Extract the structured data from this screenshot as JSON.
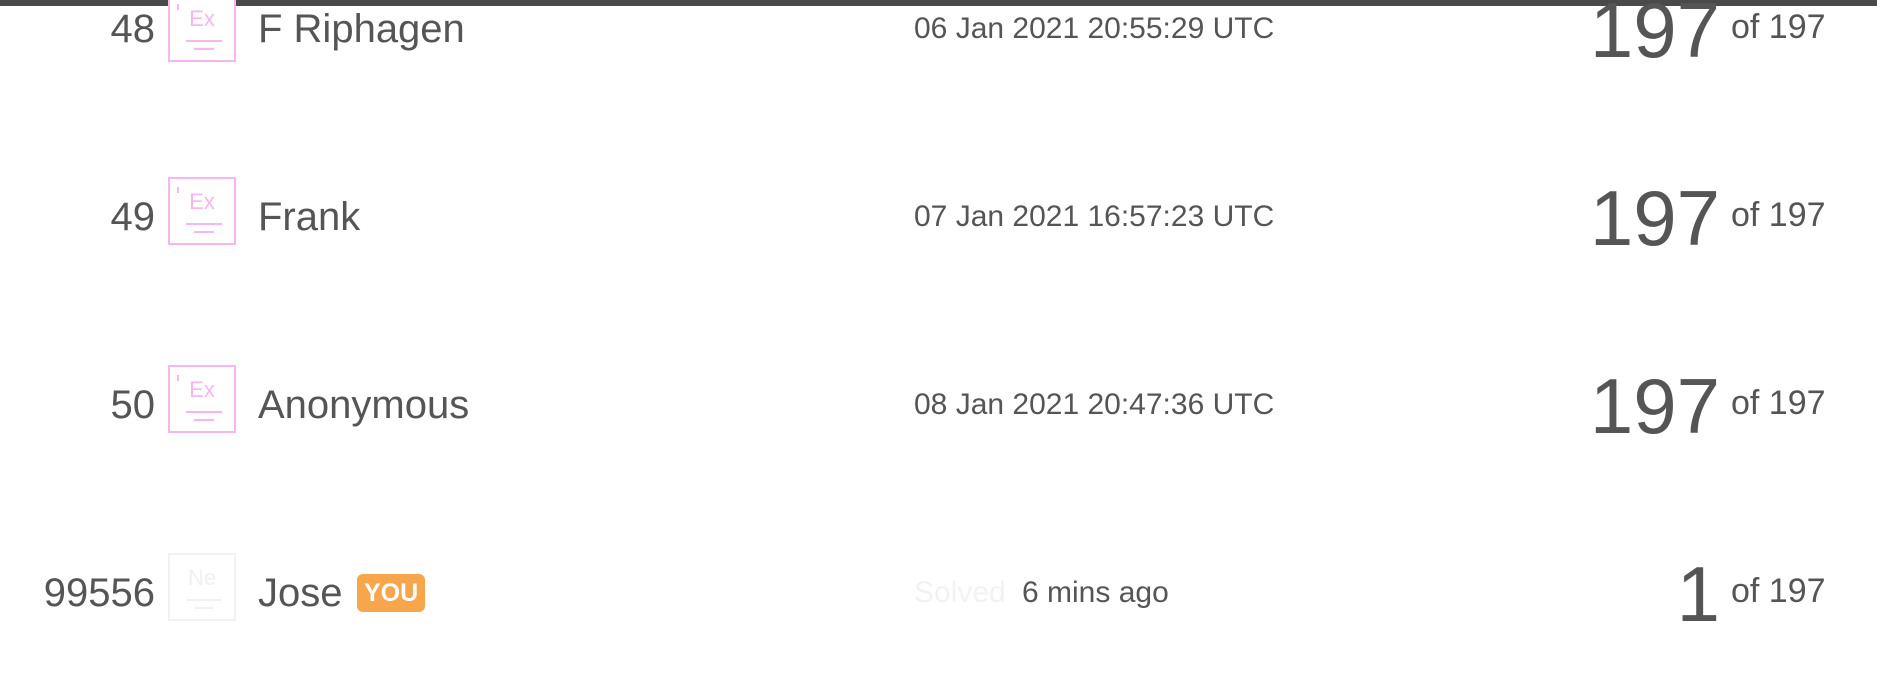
{
  "leaderboard": {
    "rows": [
      {
        "rank": "48",
        "avatar_symbol": "Ex",
        "name": "F Riphagen",
        "time": "06 Jan 2021 20:55:29 UTC",
        "score": "197",
        "of_total": "of 197"
      },
      {
        "rank": "49",
        "avatar_symbol": "Ex",
        "name": "Frank",
        "time": "07 Jan 2021 16:57:23 UTC",
        "score": "197",
        "of_total": "of 197"
      },
      {
        "rank": "50",
        "avatar_symbol": "Ex",
        "name": "Anonymous",
        "time": "08 Jan 2021 20:47:36 UTC",
        "score": "197",
        "of_total": "of 197"
      }
    ],
    "current_user": {
      "rank": "99556",
      "avatar_symbol": "Ne",
      "name": "Jose",
      "badge": "YOU",
      "solved_label": "Solved",
      "time_ago": "6 mins ago",
      "score": "1",
      "of_total": "of 197"
    }
  },
  "colors": {
    "text": "#555555",
    "avatar_border": "#f7b6f3",
    "badge_bg": "#f7a64b",
    "top_bar": "#4a4a4a"
  }
}
